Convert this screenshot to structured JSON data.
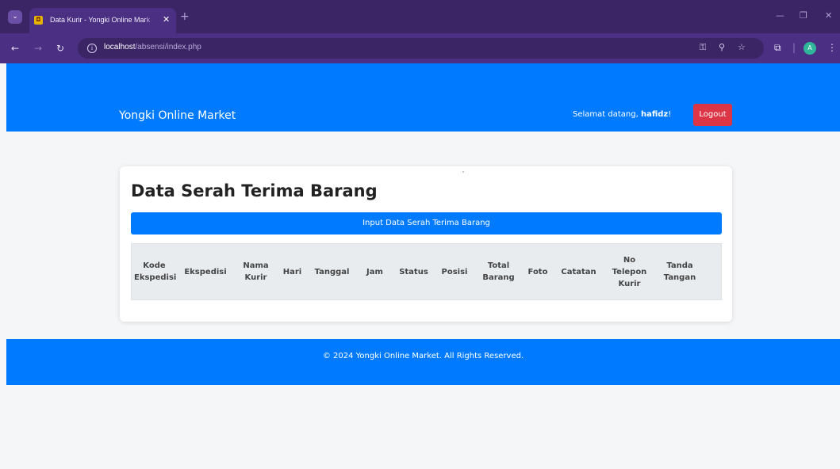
{
  "browser": {
    "tab_title": "Data Kurir - Yongki Online Mar",
    "tab_title_fade": "k",
    "tab_close": "✕",
    "new_tab": "+",
    "url_host": "localhost",
    "url_path": "/absensi/index.php",
    "icons": [
      "tab-search-icon",
      "back-icon",
      "forward-icon",
      "reload-icon",
      "info-icon",
      "password-key-icon",
      "zoom-icon",
      "bookmark-star-icon",
      "extensions-icon",
      "profile-avatar",
      "more-menu-icon",
      "minimize-icon",
      "maximize-icon",
      "close-window-icon"
    ],
    "avatar_letter": "A"
  },
  "navbar": {
    "brand": "Yongki Online Market",
    "welcome_prefix": "Selamat datang, ",
    "username": "hafidz",
    "welcome_suffix": "!",
    "logout_label": "Logout"
  },
  "main": {
    "title": "Data Serah Terima Barang",
    "input_button_label": "Input Data Serah Terima Barang",
    "table_headers": [
      "Kode Ekspedisi",
      "Ekspedisi",
      "Nama Kurir",
      "Hari",
      "Tanggal",
      "Jam",
      "Status",
      "Posisi",
      "Total Barang",
      "Foto",
      "Catatan",
      "No Telepon Kurir",
      "Tanda Tangan"
    ]
  },
  "footer": {
    "text": "© 2024 Yongki Online Market. All Rights Reserved."
  },
  "colors": {
    "primary": "#007bff",
    "danger": "#dc3545",
    "browser_frame": "#3b2565",
    "page_bg": "#f5f6f7"
  }
}
